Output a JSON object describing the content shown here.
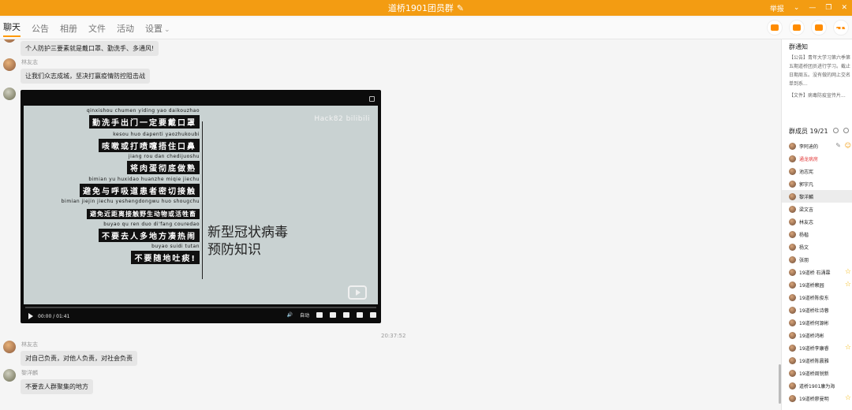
{
  "window": {
    "title": "道桥1901团员群",
    "controls": [
      "举报"
    ]
  },
  "tabs": {
    "items": [
      "聊天",
      "公告",
      "相册",
      "文件",
      "活动",
      "设置"
    ],
    "active": "聊天"
  },
  "chat": {
    "messages": [
      {
        "sender": "",
        "text": "个人防护三要素就是戴口罩、勤洗手、多通风!"
      },
      {
        "sender": "林友志",
        "text": "让我们众志成城，坚决打赢疫情防控阻击战"
      },
      {
        "sender": "林友志",
        "text": "对自己负责，对他人负责，对社会负责"
      },
      {
        "sender": "黎洋麟",
        "text": "不要去人群聚集的地方"
      }
    ],
    "timestamp": "20:37:52"
  },
  "video": {
    "watermark": "Hack82  bilibili",
    "slogans": [
      {
        "pinyin": "qinxishou  chumen yiding yao daikouzhao",
        "text": "勤洗手出门一定要戴口罩"
      },
      {
        "pinyin": "kesou huo dapenti  yaozhukoubi",
        "text": "咳嗽或打喷嚏捂住口鼻"
      },
      {
        "pinyin": "jiang rou dan chedijuoshu",
        "text": "将肉蛋彻底做熟"
      },
      {
        "pinyin": "bimian yu huxidao huanzhe  miqie  jiechu",
        "text": "避免与呼吸道患者密切接触"
      },
      {
        "pinyin": "bimian jiejin  jiechu yeshengdongwu huo shougchu",
        "text": "避免近距离接触野生动物或活牲畜"
      },
      {
        "pinyin": "buyao  qu ren duo di'fang couredao",
        "text": "不要去人多地方凑热闹"
      },
      {
        "pinyin": "buyao  suidi  tutan",
        "text": "不要随地吐痰!"
      }
    ],
    "title_line1": "新型冠状病毒",
    "title_line2": "预防知识",
    "time": "00:00 / 01:41",
    "auto_label": "自动"
  },
  "sidebar": {
    "notice_title": "群通知",
    "notice_text": "【公告】青年大学习第六季第五期道桥团员进行学习。截止日期周五。没有做的网上交名单到系...",
    "notice_file": "【文件】病毒防疫宣传片...",
    "members_title": "群成员 19/21",
    "members": [
      {
        "name": "李阿迪的",
        "red": false,
        "badge": "owner"
      },
      {
        "name": "通龙病房",
        "red": true,
        "badge": ""
      },
      {
        "name": "池志宪",
        "red": false,
        "badge": ""
      },
      {
        "name": "郭宇凡",
        "red": false,
        "badge": ""
      },
      {
        "name": "黎洋麟",
        "red": false,
        "badge": "",
        "selected": true
      },
      {
        "name": "梁文吉",
        "red": false,
        "badge": ""
      },
      {
        "name": "林友志",
        "red": false,
        "badge": ""
      },
      {
        "name": "杨楷",
        "red": false,
        "badge": ""
      },
      {
        "name": "杨文",
        "red": false,
        "badge": ""
      },
      {
        "name": "张朋",
        "red": false,
        "badge": ""
      },
      {
        "name": "19道桥 石涌霖",
        "red": false,
        "badge": "star"
      },
      {
        "name": "19道桥赖园",
        "red": false,
        "badge": "star"
      },
      {
        "name": "19道桥陈俊东",
        "red": false,
        "badge": ""
      },
      {
        "name": "19道桥杜诗蓉",
        "red": false,
        "badge": ""
      },
      {
        "name": "19道桥何源彬",
        "red": false,
        "badge": ""
      },
      {
        "name": "19道桥鸿彬",
        "red": false,
        "badge": ""
      },
      {
        "name": "19道桥李康睿",
        "red": false,
        "badge": "star"
      },
      {
        "name": "19道桥陈晨雅",
        "red": false,
        "badge": ""
      },
      {
        "name": "19道桥周锐新",
        "red": false,
        "badge": ""
      },
      {
        "name": "道桥1901康为海",
        "red": false,
        "badge": ""
      },
      {
        "name": "19道桥廖曼明",
        "red": false,
        "badge": "star"
      }
    ]
  }
}
